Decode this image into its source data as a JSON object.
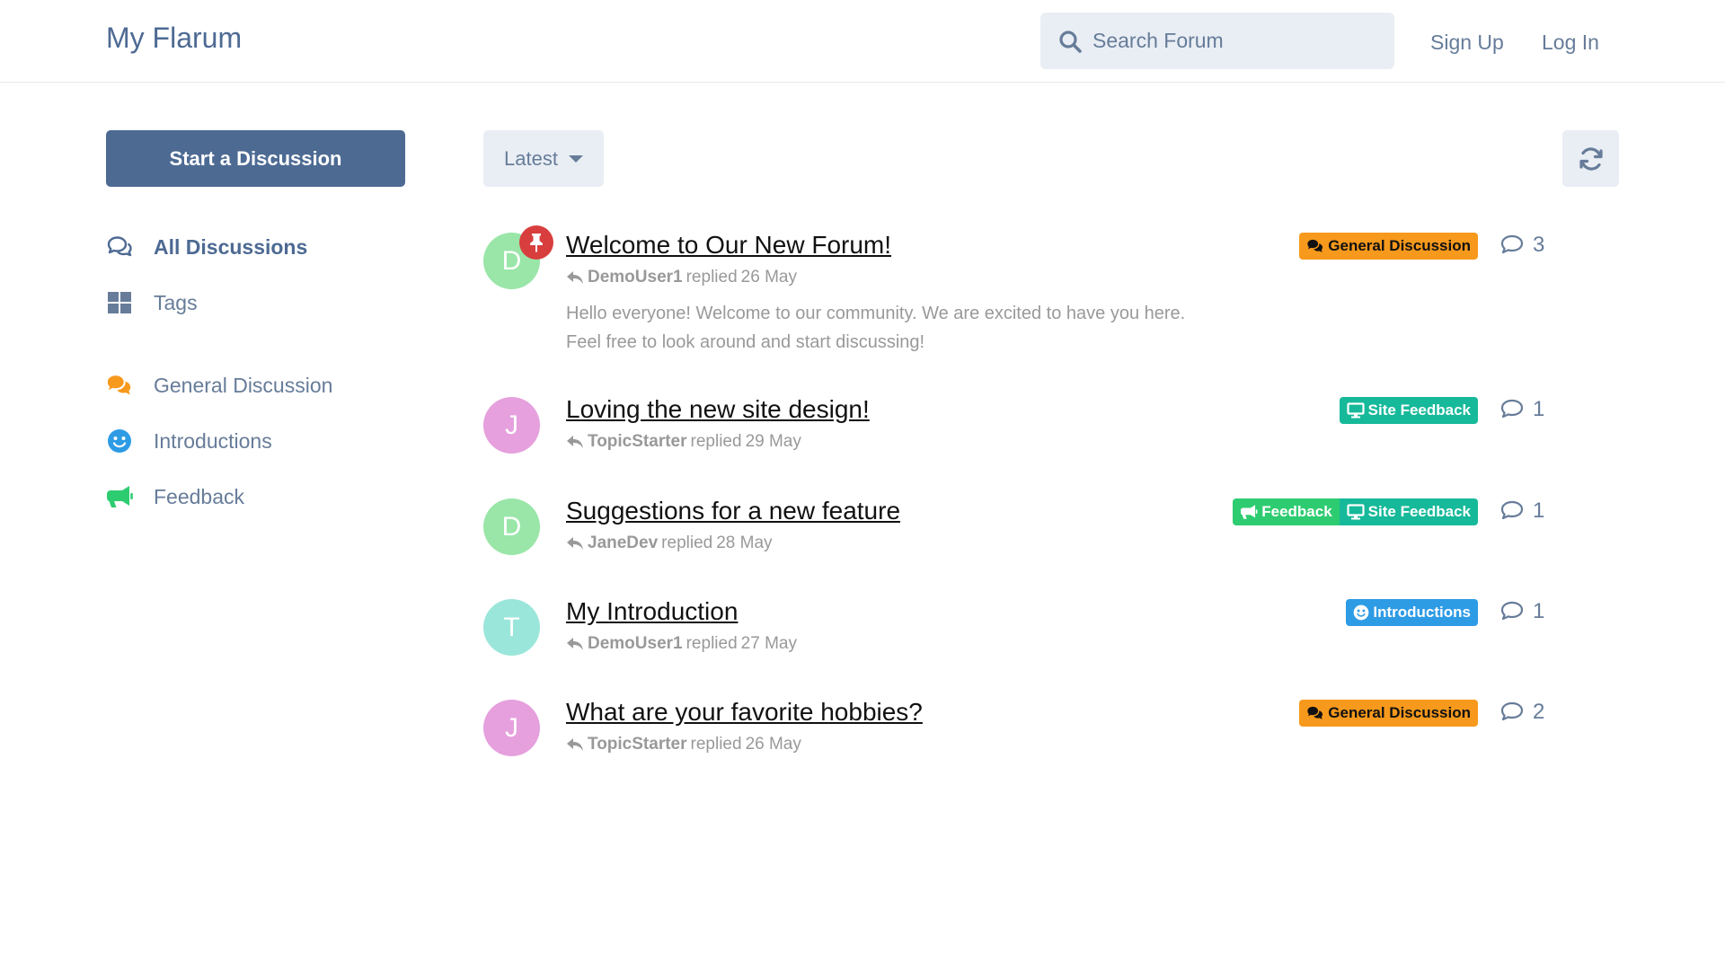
{
  "header": {
    "brand": "My Flarum",
    "search_placeholder": "Search Forum",
    "signup_label": "Sign Up",
    "login_label": "Log In"
  },
  "sidebar": {
    "start_label": "Start a Discussion",
    "nav": [
      {
        "label": "All Discussions",
        "icon": "comments-outline-icon",
        "active": true
      },
      {
        "label": "Tags",
        "icon": "grid-icon",
        "active": false
      }
    ],
    "tags": [
      {
        "label": "General Discussion",
        "icon": "comments-icon",
        "color": "#f7991c"
      },
      {
        "label": "Introductions",
        "icon": "smile-icon",
        "color": "#2e9be5"
      },
      {
        "label": "Feedback",
        "icon": "bullhorn-icon",
        "color": "#2ecc71"
      }
    ]
  },
  "toolbar": {
    "sort_label": "Latest"
  },
  "discussions": [
    {
      "title": "Welcome to Our New Forum!",
      "avatar_letter": "D",
      "avatar_color": "#99e6a8",
      "pinned": true,
      "user": "DemoUser1",
      "action": "replied",
      "date": "26 May",
      "excerpt": "Hello everyone! Welcome to our community. We are excited to have you here. Feel free to look around and start discussing!",
      "replies": "3",
      "tags": [
        {
          "label": "General Discussion",
          "color": "#f7991c",
          "text_color": "#111111",
          "icon": "comments-icon"
        }
      ]
    },
    {
      "title": "Loving the new site design!",
      "avatar_letter": "J",
      "avatar_color": "#e6a0dd",
      "pinned": false,
      "user": "TopicStarter",
      "action": "replied",
      "date": "29 May",
      "excerpt": "",
      "replies": "1",
      "tags": [
        {
          "label": "Site Feedback",
          "color": "#16b99a",
          "text_color": "#ffffff",
          "icon": "desktop-icon"
        }
      ]
    },
    {
      "title": "Suggestions for a new feature",
      "avatar_letter": "D",
      "avatar_color": "#99e6a8",
      "pinned": false,
      "user": "JaneDev",
      "action": "replied",
      "date": "28 May",
      "excerpt": "",
      "replies": "1",
      "tags": [
        {
          "label": "Feedback",
          "color": "#2ecc71",
          "text_color": "#ffffff",
          "icon": "bullhorn-icon"
        },
        {
          "label": "Site Feedback",
          "color": "#16b99a",
          "text_color": "#ffffff",
          "icon": "desktop-icon"
        }
      ]
    },
    {
      "title": "My Introduction",
      "avatar_letter": "T",
      "avatar_color": "#9be6db",
      "pinned": false,
      "user": "DemoUser1",
      "action": "replied",
      "date": "27 May",
      "excerpt": "",
      "replies": "1",
      "tags": [
        {
          "label": "Introductions",
          "color": "#2e9be5",
          "text_color": "#ffffff",
          "icon": "smile-icon"
        }
      ]
    },
    {
      "title": "What are your favorite hobbies?",
      "avatar_letter": "J",
      "avatar_color": "#e6a0dd",
      "pinned": false,
      "user": "TopicStarter",
      "action": "replied",
      "date": "26 May",
      "excerpt": "",
      "replies": "2",
      "tags": [
        {
          "label": "General Discussion",
          "color": "#f7991c",
          "text_color": "#111111",
          "icon": "comments-icon"
        }
      ]
    }
  ]
}
